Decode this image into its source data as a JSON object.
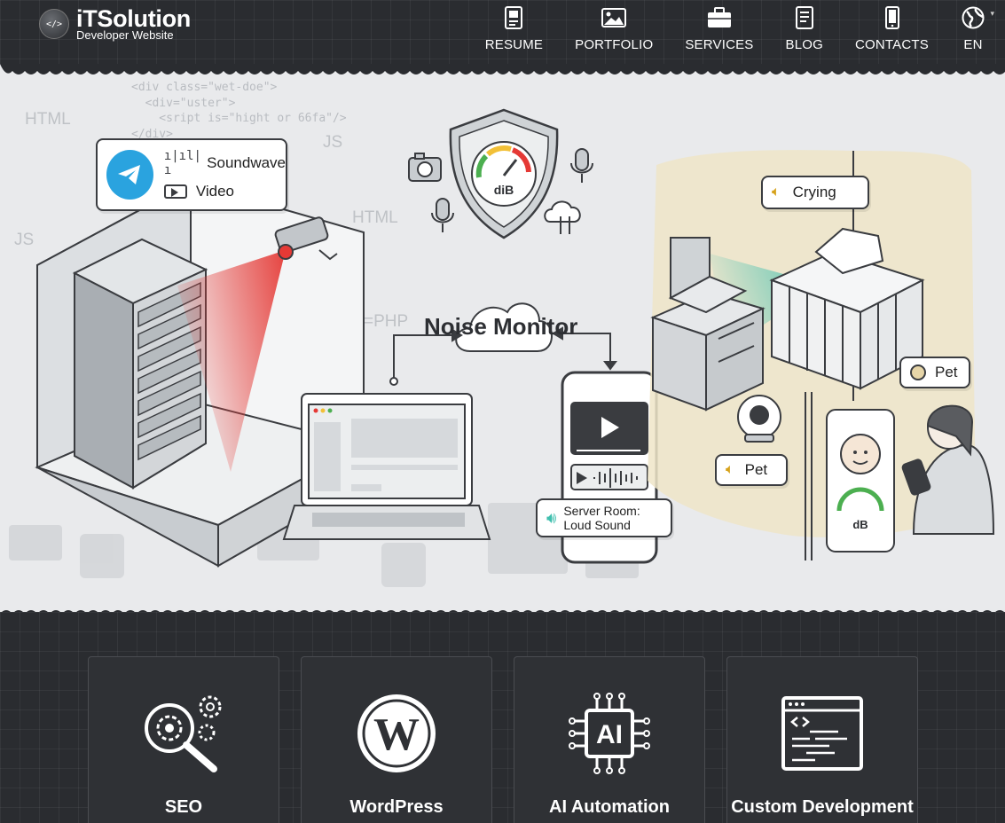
{
  "brand": {
    "title": "iTSolution",
    "subtitle": "Developer Website",
    "logo_glyph": "</>"
  },
  "nav": {
    "items": [
      {
        "label": "RESUME",
        "icon": "resume-icon"
      },
      {
        "label": "PORTFOLIO",
        "icon": "image-icon"
      },
      {
        "label": "SERVICES",
        "icon": "briefcase-icon"
      },
      {
        "label": "BLOG",
        "icon": "notebook-icon"
      },
      {
        "label": "CONTACTS",
        "icon": "phone-icon"
      },
      {
        "label": "EN",
        "icon": "globe-icon"
      }
    ]
  },
  "hero": {
    "title": "Noise Monitor",
    "code_lines": [
      "<div class=\"wet-doe\">",
      "  <div=\"uster\">",
      "    <sript is=\"hight or 66fa\"/>",
      "</div>"
    ],
    "code_words": [
      "HTML",
      "JS",
      "HTML",
      "JS",
      "=PHP"
    ],
    "telegram_bubble": {
      "line1": "Soundwave",
      "line2": "Video"
    },
    "meter_label": "diB",
    "phone_alert": {
      "line1": "Server Room:",
      "line2": "Loud Sound"
    },
    "crying_bubble": "Crying",
    "pet_bubble_top": "Pet",
    "pet_bubble_bottom": "Pet",
    "phone_meter_label": "dB"
  },
  "services": [
    {
      "label": "SEO",
      "icon": "seo-gears-icon"
    },
    {
      "label": "WordPress",
      "icon": "wordpress-icon"
    },
    {
      "label": "AI Automation",
      "icon": "ai-chip-icon"
    },
    {
      "label": "Custom Development",
      "icon": "code-window-icon"
    }
  ],
  "colors": {
    "header_bg": "#2a2c30",
    "hero_bg": "#e9eaec",
    "telegram": "#2aa3df",
    "laser": "#e53935",
    "accent_teal": "#3fbfae",
    "nursery_floor": "#efe5c8"
  }
}
